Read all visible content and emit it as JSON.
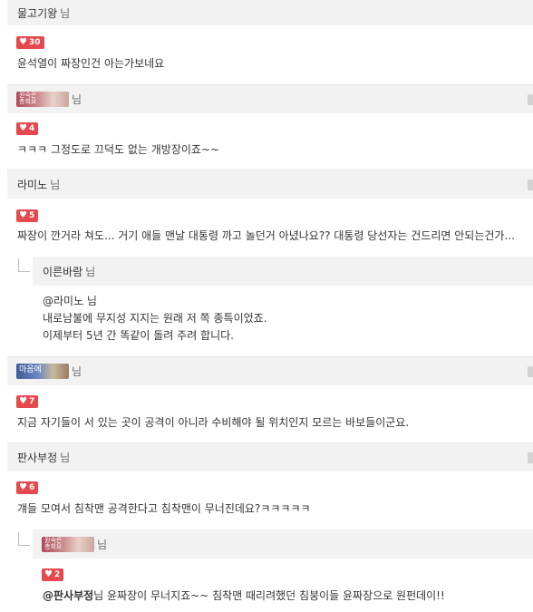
{
  "comments": [
    {
      "author": "물고기왕",
      "suffix": "님",
      "likes": "30",
      "text": "윤석열이 짜장인건 아는가보네요"
    },
    {
      "author_image_text": "원숙은\n총회요",
      "suffix": "님",
      "likes": "4",
      "text": "ㅋㅋㅋ 그정도로 끄덕도 없는 개방장이죠~~"
    },
    {
      "author": "라미노",
      "suffix": "님",
      "likes": "5",
      "text": "짜장이 깐거라 쳐도... 거기 애들 맨날 대통령 까고 놀던거 아녔나요?? 대통령 당선자는 건드리면 안되는건가..."
    },
    {
      "author": "이른바람",
      "suffix": "님",
      "lines": [
        "@라미노 님",
        "내로남불에 무지성 지지는 원래 저 쪽 종특이었죠.",
        "이제부터 5년 간 똑같이 돌려 주려 합니다."
      ]
    },
    {
      "author_image_text": "마음에",
      "suffix": "님",
      "likes": "7",
      "text": "지금 자기들이 서 있는 곳이 공격이 아니라 수비해야 될 위치인지 모르는 바보들이군요."
    },
    {
      "author": "판사부정",
      "suffix": "님",
      "likes": "6",
      "text": "걔들 모여서 침착맨 공격한다고 침착맨이 무너진데요?ㅋㅋㅋㅋㅋ"
    },
    {
      "author_image_text": "원숙은\n총회요",
      "suffix": "님",
      "likes": "2",
      "mention": "@판사부정",
      "text": "님 윤짜장이 무너지죠~~ 침착맨 때리려했던 침붕이들 윤짜장으로 원펀데이!!"
    }
  ],
  "heart_icon": "heart-icon"
}
